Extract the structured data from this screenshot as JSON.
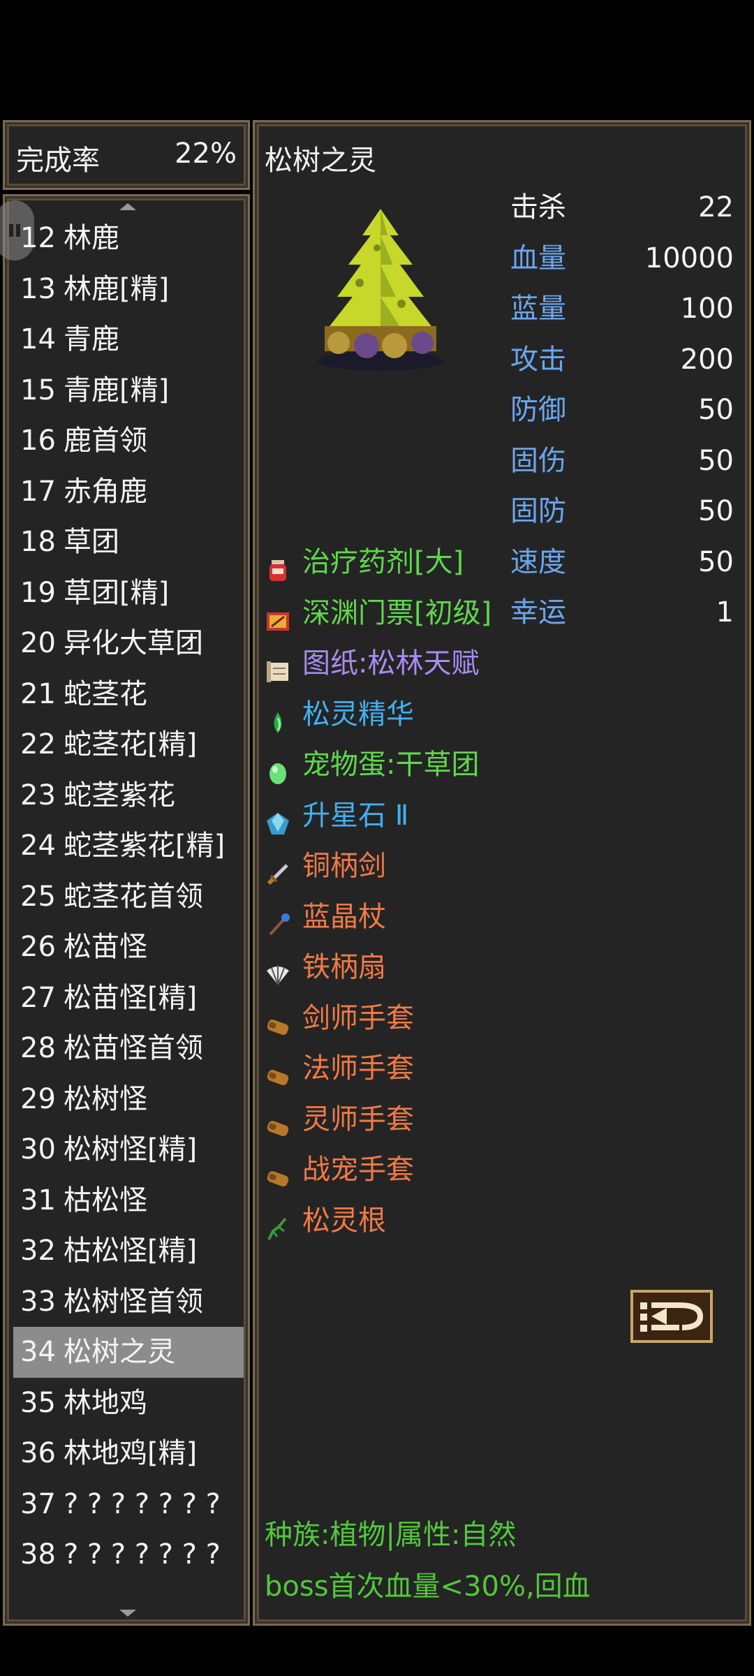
{
  "completion": {
    "label": "完成率",
    "value": "22%"
  },
  "list": [
    {
      "num": "12",
      "name": "林鹿"
    },
    {
      "num": "13",
      "name": "林鹿[精]"
    },
    {
      "num": "14",
      "name": "青鹿"
    },
    {
      "num": "15",
      "name": "青鹿[精]"
    },
    {
      "num": "16",
      "name": "鹿首领"
    },
    {
      "num": "17",
      "name": "赤角鹿"
    },
    {
      "num": "18",
      "name": "草团"
    },
    {
      "num": "19",
      "name": "草团[精]"
    },
    {
      "num": "20",
      "name": "异化大草团"
    },
    {
      "num": "21",
      "name": "蛇茎花"
    },
    {
      "num": "22",
      "name": "蛇茎花[精]"
    },
    {
      "num": "23",
      "name": "蛇茎紫花"
    },
    {
      "num": "24",
      "name": "蛇茎紫花[精]"
    },
    {
      "num": "25",
      "name": "蛇茎花首领"
    },
    {
      "num": "26",
      "name": "松苗怪"
    },
    {
      "num": "27",
      "name": "松苗怪[精]"
    },
    {
      "num": "28",
      "name": "松苗怪首领"
    },
    {
      "num": "29",
      "name": "松树怪"
    },
    {
      "num": "30",
      "name": "松树怪[精]"
    },
    {
      "num": "31",
      "name": "枯松怪"
    },
    {
      "num": "32",
      "name": "枯松怪[精]"
    },
    {
      "num": "33",
      "name": "松树怪首领"
    },
    {
      "num": "34",
      "name": "松树之灵"
    },
    {
      "num": "35",
      "name": "林地鸡"
    },
    {
      "num": "36",
      "name": "林地鸡[精]"
    },
    {
      "num": "37",
      "name": "? ? ? ? ? ? ?"
    },
    {
      "num": "38",
      "name": "? ? ? ? ? ? ?"
    }
  ],
  "selected_index": 22,
  "detail": {
    "name": "松树之灵",
    "stats": [
      {
        "label": "击杀",
        "value": "22",
        "color": "#f4f4f4"
      },
      {
        "label": "血量",
        "value": "10000",
        "color": "#6aa6f0"
      },
      {
        "label": "蓝量",
        "value": "100",
        "color": "#6aa6f0"
      },
      {
        "label": "攻击",
        "value": "200",
        "color": "#6aa6f0"
      },
      {
        "label": "防御",
        "value": "50",
        "color": "#6aa6f0"
      },
      {
        "label": "固伤",
        "value": "50",
        "color": "#6aa6f0"
      },
      {
        "label": "固防",
        "value": "50",
        "color": "#6aa6f0"
      },
      {
        "label": "速度",
        "value": "50",
        "color": "#6aa6f0"
      },
      {
        "label": "幸运",
        "value": "1",
        "color": "#6aa6f0"
      }
    ],
    "drops": [
      {
        "name": "治疗药剂[大]",
        "color": "#5ed84a",
        "icon": "potion-icon"
      },
      {
        "name": "深渊门票[初级]",
        "color": "#5ed84a",
        "icon": "ticket-icon"
      },
      {
        "name": "图纸:松林天赋",
        "color": "#a98bf0",
        "icon": "scroll-icon"
      },
      {
        "name": "松灵精华",
        "color": "#3fb0f0",
        "icon": "essence-icon"
      },
      {
        "name": "宠物蛋:干草团",
        "color": "#5ed84a",
        "icon": "egg-icon"
      },
      {
        "name": "升星石 Ⅱ",
        "color": "#3fb0f0",
        "icon": "gem-icon"
      },
      {
        "name": "铜柄剑",
        "color": "#f07a46",
        "icon": "sword-icon"
      },
      {
        "name": "蓝晶杖",
        "color": "#f07a46",
        "icon": "staff-icon"
      },
      {
        "name": "铁柄扇",
        "color": "#f07a46",
        "icon": "fan-icon"
      },
      {
        "name": "剑师手套",
        "color": "#f07a46",
        "icon": "glove-icon"
      },
      {
        "name": "法师手套",
        "color": "#f07a46",
        "icon": "glove-icon"
      },
      {
        "name": "灵师手套",
        "color": "#f07a46",
        "icon": "glove-icon"
      },
      {
        "name": "战宠手套",
        "color": "#f07a46",
        "icon": "glove-icon"
      },
      {
        "name": "松灵根",
        "color": "#f07a46",
        "icon": "root-icon"
      }
    ],
    "race_line": "种族:植物|属性:自然",
    "boss_line": "boss首次血量<30%,回血"
  }
}
